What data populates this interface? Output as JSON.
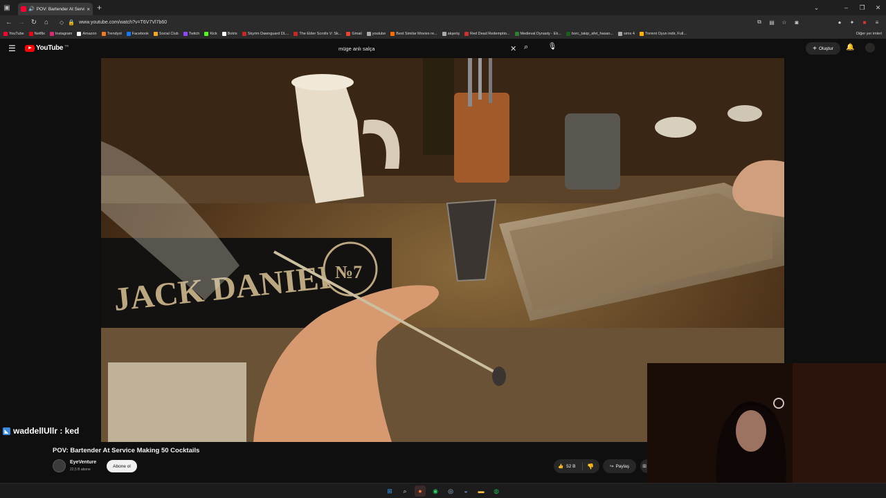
{
  "browser": {
    "tab_title": "POV: Bartender At Service Making 50 Cocktails",
    "tab_close": "×",
    "new_tab": "+",
    "url": "www.youtube.com/watch?v=T6V7Vl7b60",
    "other_bookmarks": "Diğer yer imleri",
    "bookmarks": [
      {
        "label": "YouTube",
        "color": "#ff0033"
      },
      {
        "label": "Netflix",
        "color": "#e50914"
      },
      {
        "label": "Instagram",
        "color": "#d62976"
      },
      {
        "label": "Amazon",
        "color": "#ffffff"
      },
      {
        "label": "Trendyol",
        "color": "#f27a1a"
      },
      {
        "label": "Facebook",
        "color": "#1877f2"
      },
      {
        "label": "Social Club",
        "color": "#f5a623"
      },
      {
        "label": "Twitch",
        "color": "#9146ff"
      },
      {
        "label": "Kick",
        "color": "#53fc18"
      },
      {
        "label": "Botrix",
        "color": "#ffffff"
      },
      {
        "label": "Skyrim Dawnguard DL...",
        "color": "#c62828"
      },
      {
        "label": "The Elder Scrolls V: Sk...",
        "color": "#c62828"
      },
      {
        "label": "Gmail",
        "color": "#ea4335"
      },
      {
        "label": "youtube",
        "color": "#aaaaaa"
      },
      {
        "label": "Best Similar Movies re...",
        "color": "#ff6d00"
      },
      {
        "label": "akşeriş",
        "color": "#aaaaaa"
      },
      {
        "label": "Red Dead Redemptio...",
        "color": "#d32f2f"
      },
      {
        "label": "Medieval Dynasty - Ek...",
        "color": "#2e7d32"
      },
      {
        "label": "borc_takip_afet_hasan...",
        "color": "#1b5e20"
      },
      {
        "label": "sims 4",
        "color": "#aaaaaa"
      },
      {
        "label": "Torrent Oyun indir, Full...",
        "color": "#ffb300"
      }
    ]
  },
  "youtube": {
    "logo": "YouTube",
    "country": "TR",
    "search_query": "müge anlı salça",
    "create_label": "Oluştur"
  },
  "video": {
    "title": "POV: Bartender At Service Making 50 Cocktails",
    "channel": "EyeVenture",
    "subscribers": "22,5 B abone",
    "subscribe_label": "Abone ol",
    "likes": "52 B",
    "share_label": "Paylaş"
  },
  "overlay": {
    "chat_message": "waddellUllr : ked"
  }
}
